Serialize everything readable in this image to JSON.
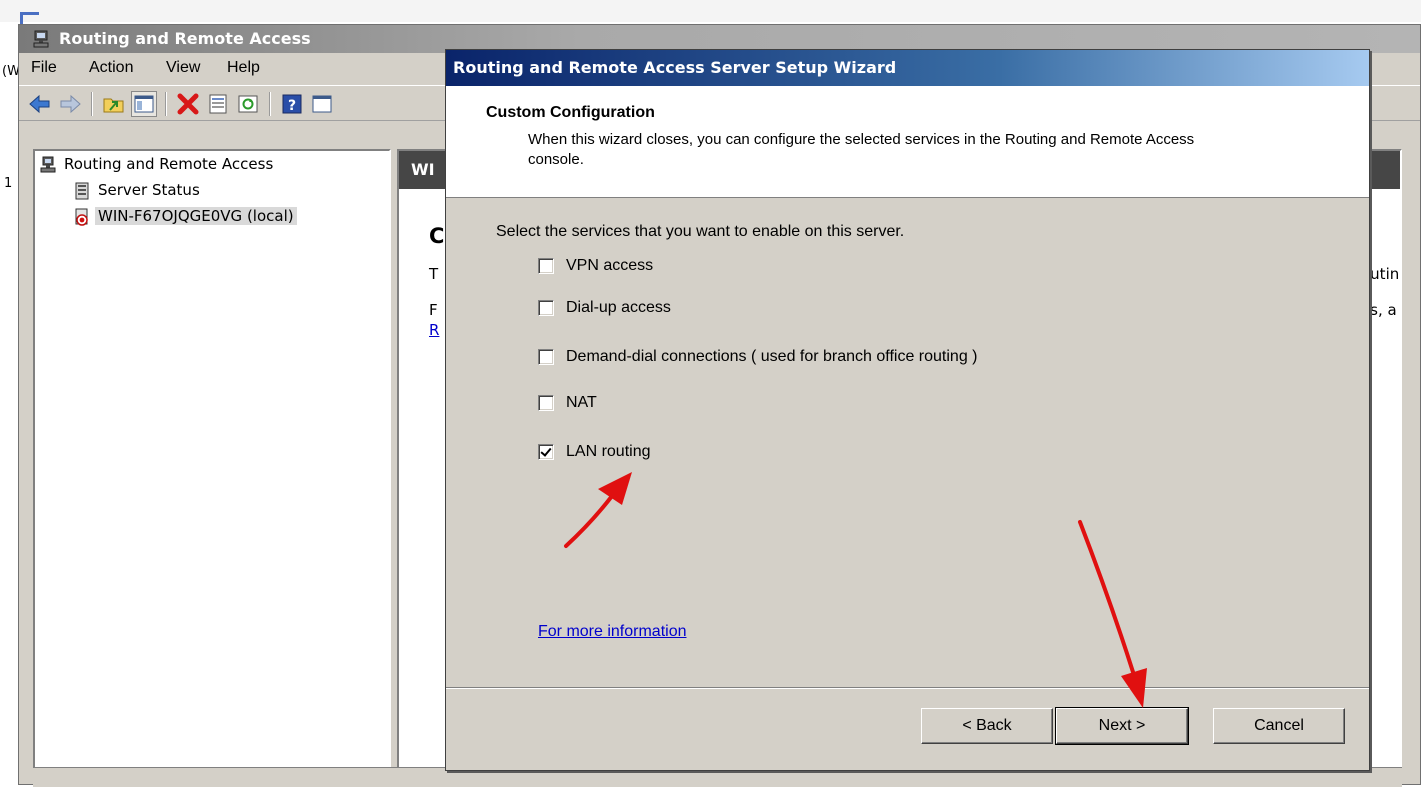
{
  "background": {
    "left_fragment_1": "(W",
    "left_fragment_2": "1"
  },
  "mmc": {
    "title": "Routing and Remote Access",
    "menu": [
      "File",
      "Action",
      "View",
      "Help"
    ],
    "tree": {
      "root": "Routing and Remote Access",
      "server_status": "Server Status",
      "server": "WIN-F67OJQGE0VG (local)"
    },
    "right_pane": {
      "header_fragment": "WI",
      "heading_fragment": "C",
      "line1_fragment": "T",
      "line2_fragment": "F",
      "link_fragment": "R",
      "right_fragment_1": "outin",
      "right_fragment_2": "os, a"
    }
  },
  "wizard": {
    "title": "Routing and Remote Access Server Setup Wizard",
    "heading": "Custom Configuration",
    "subheading": "When this wizard closes, you can configure the selected services in the Routing and Remote Access console.",
    "prompt": "Select the services that you want to enable on this server.",
    "options": [
      {
        "label": "VPN access",
        "checked": false
      },
      {
        "label": "Dial-up access",
        "checked": false
      },
      {
        "label": "Demand-dial connections ( used for branch office routing )",
        "checked": false
      },
      {
        "label": "NAT",
        "checked": false
      },
      {
        "label": "LAN routing",
        "checked": true
      }
    ],
    "more_info": "For more information ",
    "buttons": {
      "back": "< Back",
      "next": "Next >",
      "cancel": "Cancel"
    }
  },
  "colors": {
    "annotation_arrow": "#e01010",
    "wizard_title_bar": "#0a246a",
    "link": "#0000cc"
  }
}
